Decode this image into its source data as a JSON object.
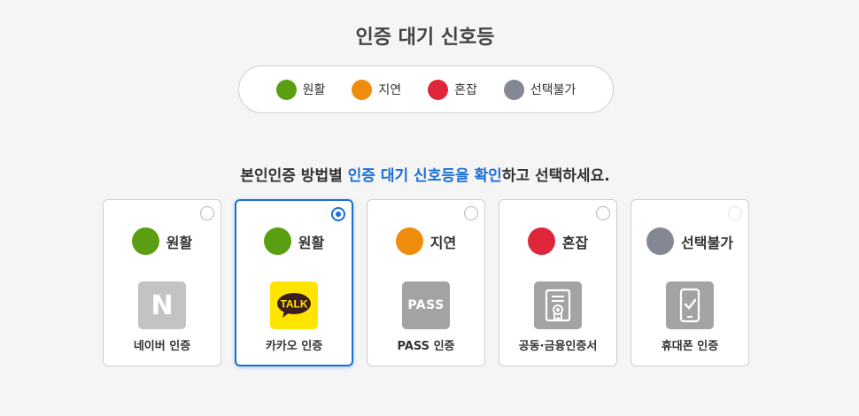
{
  "title": "인증 대기 신호등",
  "legend": [
    {
      "label": "원활",
      "color": "#5a9e12"
    },
    {
      "label": "지연",
      "color": "#f08c0b"
    },
    {
      "label": "혼잡",
      "color": "#e0263a"
    },
    {
      "label": "선택불가",
      "color": "#838894"
    }
  ],
  "instruction": {
    "before": "본인인증 방법별 ",
    "highlight": "인증 대기 신호등을 확인",
    "after": "하고 선택하세요."
  },
  "accent_color": "#1a6fd6",
  "methods": [
    {
      "status": "원활",
      "status_color": "#5a9e12",
      "name": "네이버 인증",
      "icon": "naver-icon",
      "logo_text": "N",
      "selected": false,
      "disabled": false
    },
    {
      "status": "원활",
      "status_color": "#5a9e12",
      "name": "카카오 인증",
      "icon": "kakao-talk-icon",
      "logo_text": "TALK",
      "selected": true,
      "disabled": false
    },
    {
      "status": "지연",
      "status_color": "#f08c0b",
      "name": "PASS 인증",
      "icon": "pass-icon",
      "logo_text": "PASS",
      "selected": false,
      "disabled": false
    },
    {
      "status": "혼잡",
      "status_color": "#e0263a",
      "name": "공동·금융인증서",
      "icon": "certificate-icon",
      "selected": false,
      "disabled": false
    },
    {
      "status": "선택불가",
      "status_color": "#838894",
      "name": "휴대폰 인증",
      "icon": "mobile-check-icon",
      "selected": false,
      "disabled": true
    }
  ]
}
